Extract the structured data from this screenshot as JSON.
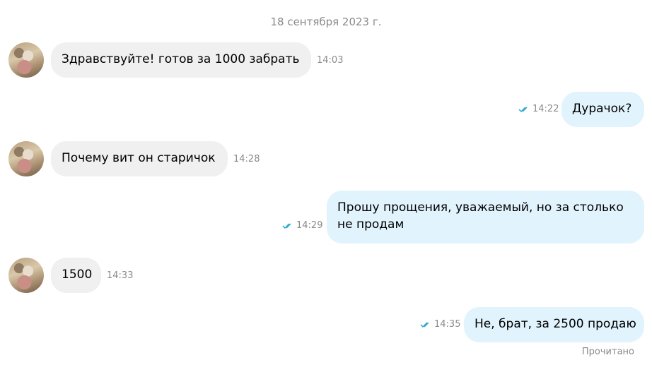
{
  "date_separator": "18 сентября 2023 г.",
  "colors": {
    "incoming_bubble": "#f0f0f0",
    "outgoing_bubble": "#e1f3fd",
    "check_mark": "#2aa3d8",
    "meta_text": "#8a8a8a"
  },
  "messages": [
    {
      "direction": "incoming",
      "text": "Здравствуйте!  готов за 1000 забрать",
      "time": "14:03"
    },
    {
      "direction": "outgoing",
      "text": "Дурачок?",
      "time": "14:22",
      "status": "read"
    },
    {
      "direction": "incoming",
      "text": "Почему  вит он старичок",
      "time": "14:28"
    },
    {
      "direction": "outgoing",
      "text": "Прошу прощения, уважаемый, но за столько",
      "text_line2": "не продам",
      "time": "14:29",
      "status": "read"
    },
    {
      "direction": "incoming",
      "text": "1500",
      "time": "14:33"
    },
    {
      "direction": "outgoing",
      "text": "Не, брат, за 2500 продаю",
      "time": "14:35",
      "status": "read"
    }
  ],
  "read_receipt": "Прочитано"
}
